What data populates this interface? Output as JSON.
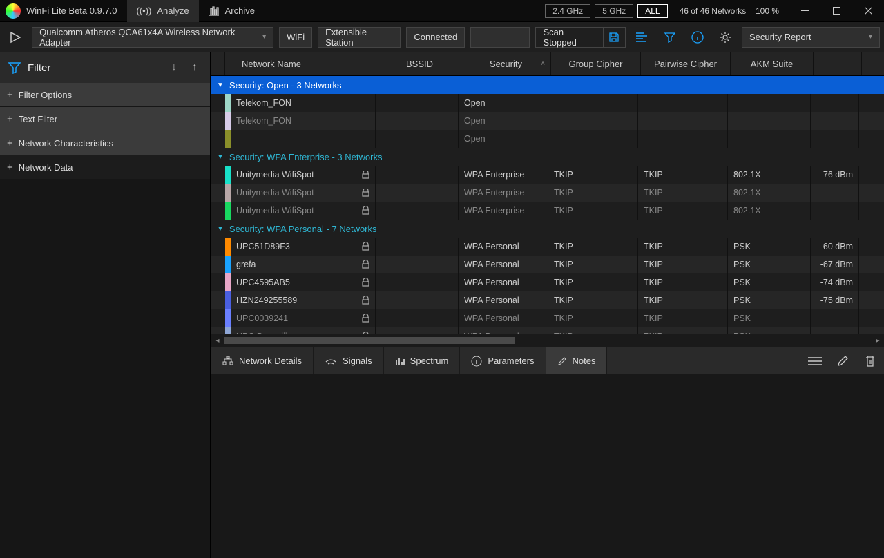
{
  "title": "WinFi Lite Beta 0.9.7.0",
  "tabs": {
    "analyze": "Analyze",
    "archive": "Archive"
  },
  "bands": {
    "g24": "2.4 GHz",
    "g5": "5 GHz",
    "all": "ALL"
  },
  "stats": "46 of 46 Networks = 100 %",
  "toolbar": {
    "adapter": "Qualcomm Atheros QCA61x4A Wireless Network Adapter",
    "wifi": "WiFi",
    "mode": "Extensible Station",
    "conn": "Connected",
    "scan": "Scan Stopped",
    "report": "Security Report"
  },
  "sidebar": {
    "title": "Filter",
    "items": [
      "Filter Options",
      "Text Filter",
      "Network Characteristics",
      "Network Data"
    ]
  },
  "columns": {
    "name": "Network Name",
    "bssid": "BSSID",
    "security": "Security",
    "gc": "Group Cipher",
    "pc": "Pairwise Cipher",
    "akm": "AKM Suite"
  },
  "groups": [
    {
      "label": "Security: Open - 3 Networks",
      "style": "blue",
      "rows": [
        {
          "c": "#9ed6c8",
          "name": "Telekom_FON",
          "sec": "Open",
          "gc": "",
          "pc": "",
          "akm": "",
          "sig": "",
          "dim": false,
          "lock": false
        },
        {
          "c": "#d7cce8",
          "name": "Telekom_FON",
          "sec": "Open",
          "gc": "",
          "pc": "",
          "akm": "",
          "sig": "",
          "dim": true,
          "lock": false
        },
        {
          "c": "#8a8f2a",
          "name": "",
          "sec": "Open",
          "gc": "",
          "pc": "",
          "akm": "",
          "sig": "",
          "dim": true,
          "lock": false
        }
      ]
    },
    {
      "label": "Security: WPA Enterprise - 3 Networks",
      "style": "dk",
      "rows": [
        {
          "c": "#18e0c8",
          "name": "Unitymedia WifiSpot",
          "sec": "WPA Enterprise",
          "gc": "TKIP",
          "pc": "TKIP",
          "akm": "802.1X",
          "sig": "-76 dBm",
          "dim": false,
          "lock": true
        },
        {
          "c": "#b8a7a7",
          "name": "Unitymedia WifiSpot",
          "sec": "WPA Enterprise",
          "gc": "TKIP",
          "pc": "TKIP",
          "akm": "802.1X",
          "sig": "",
          "dim": true,
          "lock": true
        },
        {
          "c": "#18d860",
          "name": "Unitymedia WifiSpot",
          "sec": "WPA Enterprise",
          "gc": "TKIP",
          "pc": "TKIP",
          "akm": "802.1X",
          "sig": "",
          "dim": true,
          "lock": true
        }
      ]
    },
    {
      "label": "Security: WPA Personal - 7 Networks",
      "style": "dk",
      "rows": [
        {
          "c": "#ff8a00",
          "name": "UPC51D89F3",
          "sec": "WPA Personal",
          "gc": "TKIP",
          "pc": "TKIP",
          "akm": "PSK",
          "sig": "-60 dBm",
          "dim": false,
          "lock": true
        },
        {
          "c": "#1aa3ff",
          "name": "grefa",
          "sec": "WPA Personal",
          "gc": "TKIP",
          "pc": "TKIP",
          "akm": "PSK",
          "sig": "-67 dBm",
          "dim": false,
          "lock": true
        },
        {
          "c": "#e8a7c8",
          "name": "UPC4595AB5",
          "sec": "WPA Personal",
          "gc": "TKIP",
          "pc": "TKIP",
          "akm": "PSK",
          "sig": "-74 dBm",
          "dim": false,
          "lock": true
        },
        {
          "c": "#4a5fe0",
          "name": "HZN249255589",
          "sec": "WPA Personal",
          "gc": "TKIP",
          "pc": "TKIP",
          "akm": "PSK",
          "sig": "-75 dBm",
          "dim": false,
          "lock": true
        },
        {
          "c": "#6a7fff",
          "name": "UPC0039241",
          "sec": "WPA Personal",
          "gc": "TKIP",
          "pc": "TKIP",
          "akm": "PSK",
          "sig": "",
          "dim": true,
          "lock": true
        },
        {
          "c": "#8fa7d6",
          "name": "UPC Banzaiii",
          "sec": "WPA Personal",
          "gc": "TKIP",
          "pc": "TKIP",
          "akm": "PSK",
          "sig": "",
          "dim": true,
          "lock": true
        }
      ]
    }
  ],
  "detail_tabs": {
    "details": "Network Details",
    "signals": "Signals",
    "spectrum": "Spectrum",
    "parameters": "Parameters",
    "notes": "Notes"
  }
}
